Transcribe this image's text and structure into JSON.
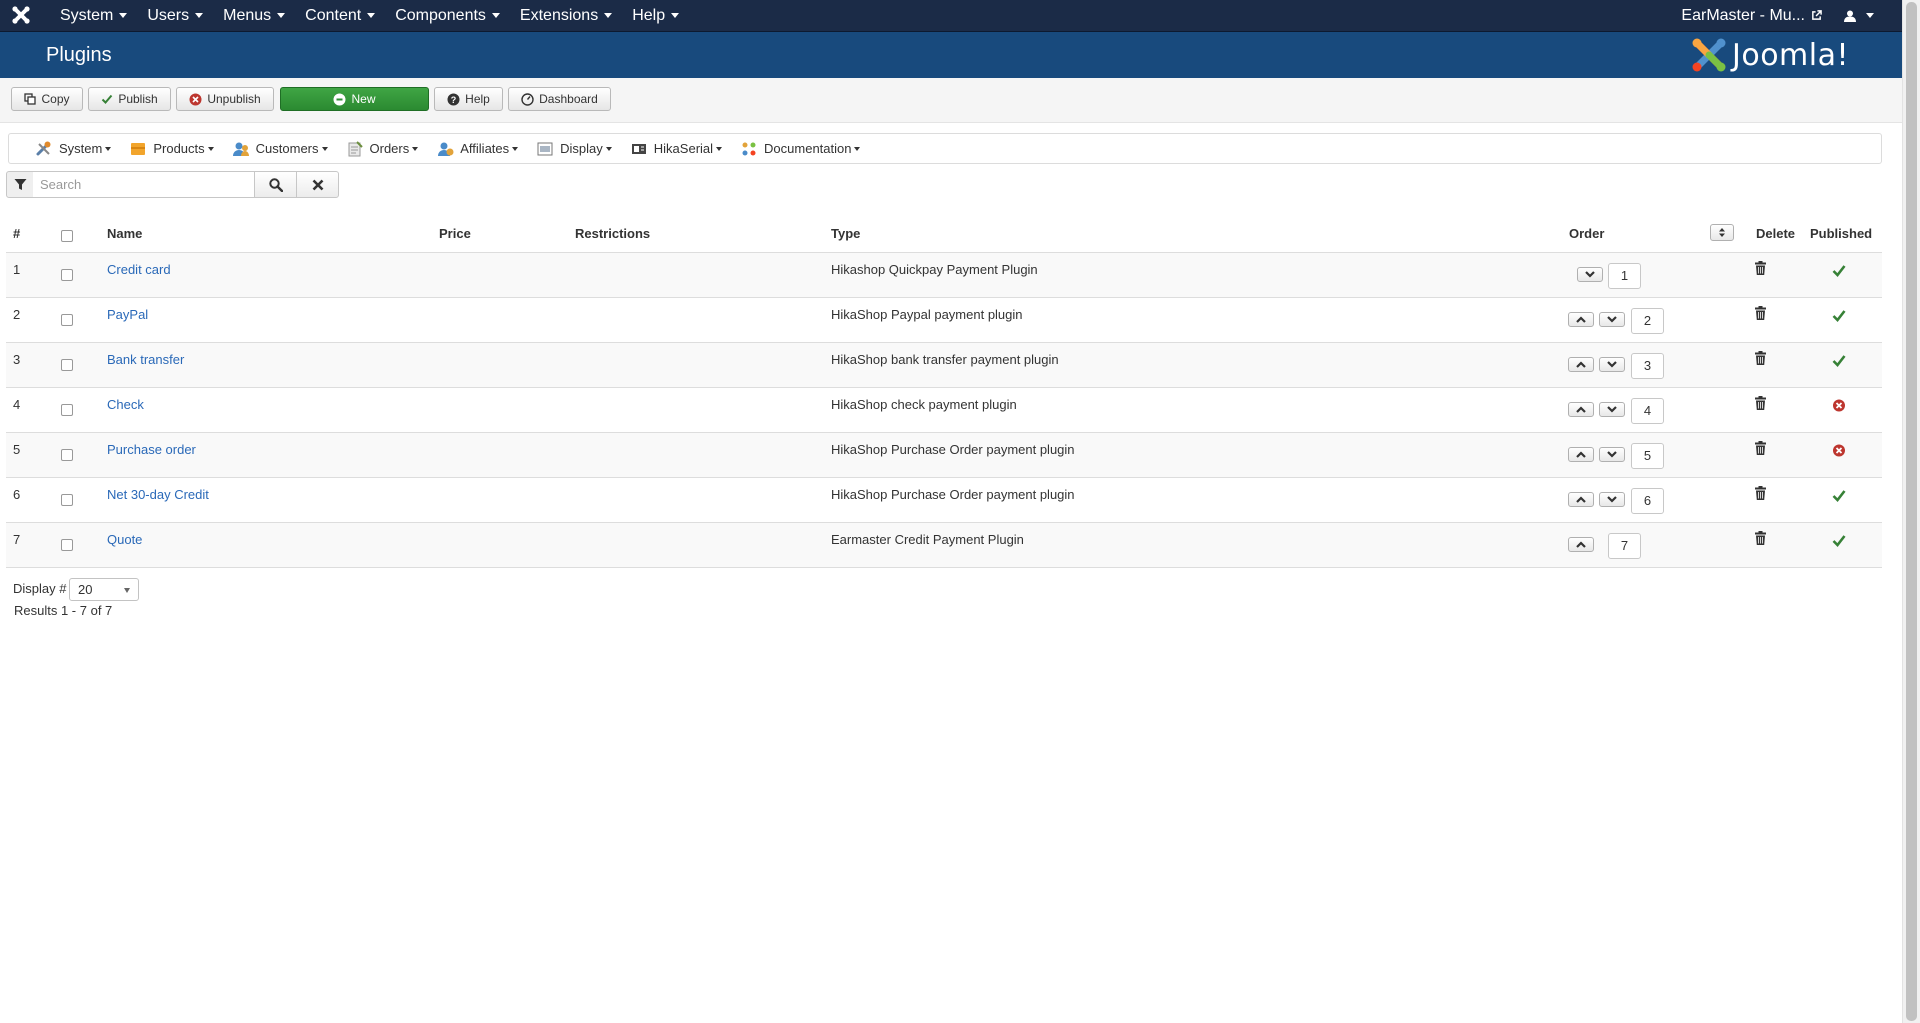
{
  "navbar": {
    "menu": [
      "System",
      "Users",
      "Menus",
      "Content",
      "Components",
      "Extensions",
      "Help"
    ],
    "site_name": "EarMaster - Mu..."
  },
  "header": {
    "title": "Plugins",
    "logo_text": "Joomla!"
  },
  "toolbar": {
    "copy": "Copy",
    "publish": "Publish",
    "unpublish": "Unpublish",
    "new": "New",
    "help": "Help",
    "dashboard": "Dashboard"
  },
  "submenu": [
    "System",
    "Products",
    "Customers",
    "Orders",
    "Affiliates",
    "Display",
    "HikaSerial",
    "Documentation"
  ],
  "search": {
    "placeholder": "Search"
  },
  "table": {
    "headers": {
      "num": "#",
      "name": "Name",
      "price": "Price",
      "restrictions": "Restrictions",
      "type": "Type",
      "order": "Order",
      "delete": "Delete",
      "published": "Published"
    },
    "rows": [
      {
        "num": "1",
        "name": "Credit card",
        "type": "Hikashop Quickpay Payment Plugin",
        "order": "1",
        "published": true,
        "up": false,
        "down": true
      },
      {
        "num": "2",
        "name": "PayPal",
        "type": "HikaShop Paypal payment plugin",
        "order": "2",
        "published": true,
        "up": true,
        "down": true
      },
      {
        "num": "3",
        "name": "Bank transfer",
        "type": "HikaShop bank transfer payment plugin",
        "order": "3",
        "published": true,
        "up": true,
        "down": true
      },
      {
        "num": "4",
        "name": "Check",
        "type": "HikaShop check payment plugin",
        "order": "4",
        "published": false,
        "up": true,
        "down": true
      },
      {
        "num": "5",
        "name": "Purchase order",
        "type": "HikaShop Purchase Order payment plugin",
        "order": "5",
        "published": false,
        "up": true,
        "down": true
      },
      {
        "num": "6",
        "name": "Net 30-day Credit",
        "type": "HikaShop Purchase Order payment plugin",
        "order": "6",
        "published": true,
        "up": true,
        "down": true
      },
      {
        "num": "7",
        "name": "Quote",
        "type": "Earmaster Credit Payment Plugin",
        "order": "7",
        "published": true,
        "up": true,
        "down": false
      }
    ]
  },
  "footer": {
    "display_label": "Display #",
    "display_value": "20",
    "results": "Results 1 - 7 of 7"
  },
  "colors": {
    "navbar_bg": "#1b2b47",
    "header_bg": "#184a7d",
    "new_button": "#2f8f35",
    "link": "#2a69b8",
    "published": "#378137",
    "unpublished": "#bd362f"
  }
}
